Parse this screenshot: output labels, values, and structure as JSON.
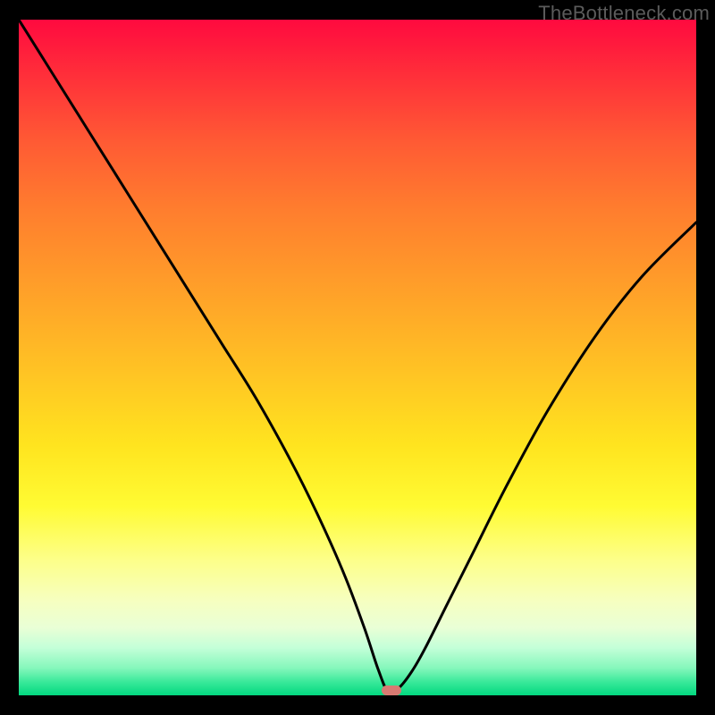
{
  "watermark": "TheBottleneck.com",
  "colors": {
    "background": "#000000",
    "curve": "#000000",
    "marker": "#d77a72",
    "gradient_top": "#ff0a3f",
    "gradient_bottom": "#02d880"
  },
  "chart_data": {
    "type": "line",
    "title": "",
    "xlabel": "",
    "ylabel": "",
    "xlim": [
      0,
      100
    ],
    "ylim": [
      0,
      100
    ],
    "marker": {
      "x": 55,
      "y": 0,
      "width": 3,
      "height": 1.5
    },
    "series": [
      {
        "name": "bottleneck-curve",
        "x": [
          0,
          5,
          10,
          15,
          20,
          25,
          30,
          35,
          40,
          44,
          48,
          51,
          53,
          54.5,
          56,
          58,
          60,
          63,
          67,
          72,
          78,
          85,
          92,
          100
        ],
        "values": [
          100,
          92,
          84,
          76,
          68,
          60,
          52,
          44,
          35,
          27,
          18,
          10,
          4,
          0.5,
          1,
          3.5,
          7,
          13,
          21,
          31,
          42,
          53,
          62,
          70
        ]
      }
    ],
    "annotations": [],
    "legend": []
  }
}
